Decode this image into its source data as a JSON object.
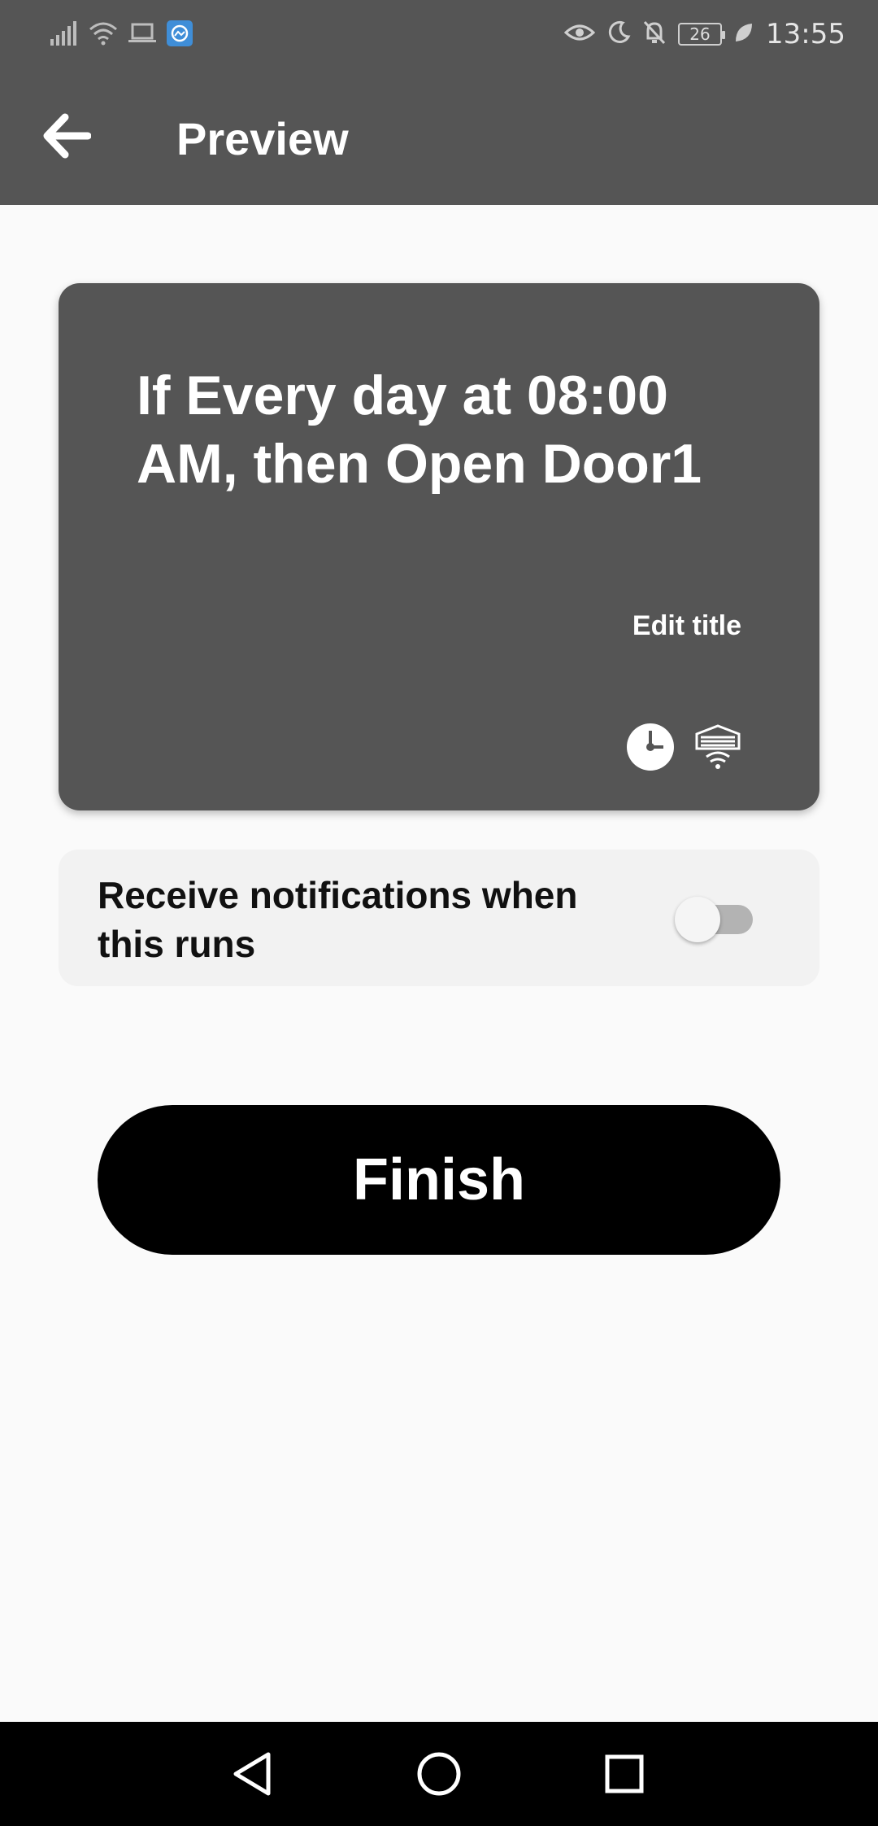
{
  "status_bar": {
    "time": "13:55",
    "battery_level": "26",
    "left_icons": [
      "signal-icon",
      "wifi-icon",
      "laptop-icon",
      "photo-app-icon"
    ],
    "right_icons": [
      "eye-comfort-icon",
      "moon-icon",
      "bell-off-icon",
      "battery-icon",
      "leaf-icon"
    ]
  },
  "app_bar": {
    "title": "Preview",
    "back_icon": "arrow-left-icon"
  },
  "applet": {
    "title": "If Every day at 08:00 AM, then Open Door1",
    "edit_title_label": "Edit title",
    "service_icons": [
      "clock-icon",
      "garage-door-icon"
    ]
  },
  "notifications": {
    "label": "Receive notifications when this runs",
    "enabled": false
  },
  "finish_button": {
    "label": "Finish"
  },
  "nav_bar": {
    "icons": [
      "back-triangle-icon",
      "home-circle-icon",
      "recents-square-icon"
    ]
  },
  "colors": {
    "header": "#555555",
    "background": "#fafafa",
    "card": "#555555",
    "button": "#000000"
  }
}
